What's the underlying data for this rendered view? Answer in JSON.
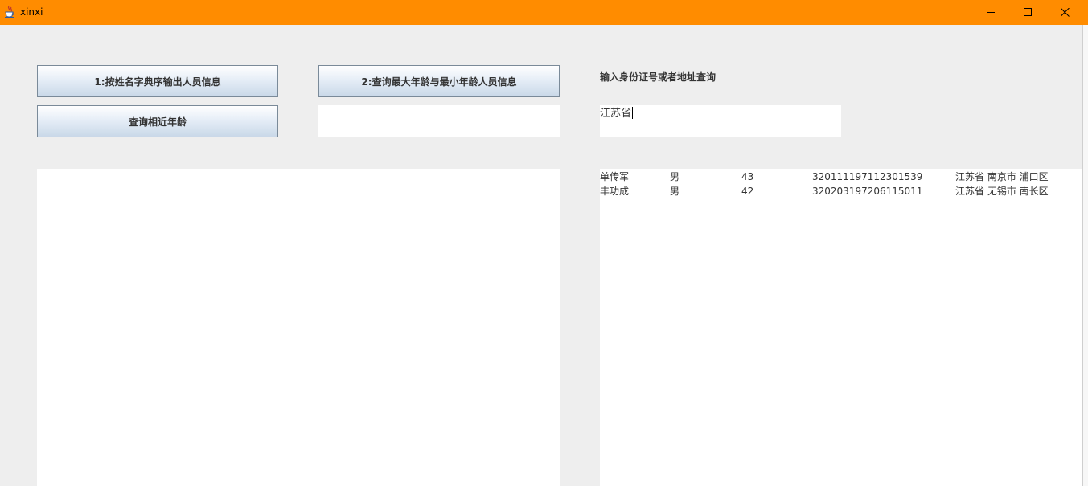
{
  "window": {
    "title": "xinxi"
  },
  "buttons": {
    "sort_by_name": "1:按姓名字典序输出人员信息",
    "max_min_age": "2:查询最大年龄与最小年龄人员信息",
    "similar_age": "查询相近年龄"
  },
  "search": {
    "label": "输入身份证号或者地址查询",
    "value": "江苏省"
  },
  "age_input": {
    "value": ""
  },
  "left_output": {
    "text": ""
  },
  "results": [
    {
      "name": "单传军",
      "gender": "男",
      "age": "43",
      "id": "320111197112301539",
      "address": "江苏省 南京市 浦口区"
    },
    {
      "name": "丰功成",
      "gender": "男",
      "age": "42",
      "id": "320203197206115011",
      "address": "江苏省 无锡市 南长区"
    }
  ],
  "icons": {
    "app": "java-cup-icon",
    "minimize": "minimize-icon",
    "maximize": "maximize-icon",
    "close": "close-icon"
  },
  "colors": {
    "titlebar": "#ff8c00",
    "background": "#eeeeee",
    "button_border": "#7a8a99"
  }
}
